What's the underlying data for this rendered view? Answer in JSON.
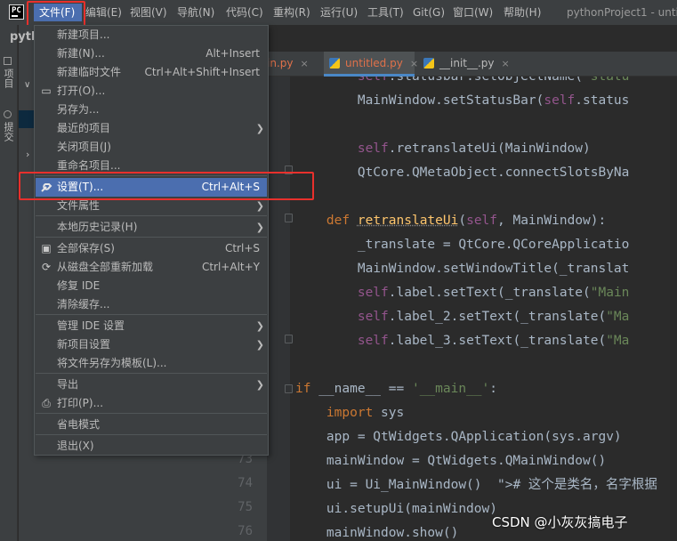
{
  "menubar": {
    "logo_text": "PC",
    "items": [
      "文件(F)",
      "编辑(E)",
      "视图(V)",
      "导航(N)",
      "代码(C)",
      "重构(R)",
      "运行(U)",
      "工具(T)",
      "Git(G)",
      "窗口(W)",
      "帮助(H)"
    ],
    "window_title": "pythonProject1 - untit"
  },
  "toolstrip": {
    "project_label": "项目",
    "commit_label": "提交"
  },
  "project_panel": {
    "title": "pyth",
    "chevron": "∨",
    "arrow": "›"
  },
  "tabs": [
    {
      "label": "in.py",
      "close": "×"
    },
    {
      "label": "untitled.py",
      "close": "×"
    },
    {
      "label": "__init__.py",
      "close": "×"
    }
  ],
  "file_menu": {
    "items": [
      {
        "label": "新建项目...",
        "shortcut": "",
        "icon": "",
        "submenu": false
      },
      {
        "label": "新建(N)...",
        "shortcut": "Alt+Insert",
        "icon": "",
        "submenu": false
      },
      {
        "label": "新建临时文件",
        "shortcut": "Ctrl+Alt+Shift+Insert",
        "icon": "",
        "submenu": false
      },
      {
        "label": "打开(O)...",
        "shortcut": "",
        "icon": "folder-icon",
        "submenu": false
      },
      {
        "label": "另存为...",
        "shortcut": "",
        "icon": "",
        "submenu": false
      },
      {
        "label": "最近的项目",
        "shortcut": "",
        "icon": "",
        "submenu": true
      },
      {
        "label": "关闭项目(J)",
        "shortcut": "",
        "icon": "",
        "submenu": false
      },
      {
        "label": "重命名项目...",
        "shortcut": "",
        "icon": "",
        "submenu": false
      },
      {
        "label": "设置(T)...",
        "shortcut": "Ctrl+Alt+S",
        "icon": "wrench-icon",
        "submenu": false,
        "active": true
      },
      {
        "label": "文件属性",
        "shortcut": "",
        "icon": "",
        "submenu": true
      },
      {
        "label": "本地历史记录(H)",
        "shortcut": "",
        "icon": "",
        "submenu": true
      },
      {
        "label": "全部保存(S)",
        "shortcut": "Ctrl+S",
        "icon": "save-icon",
        "submenu": false
      },
      {
        "label": "从磁盘全部重新加载",
        "shortcut": "Ctrl+Alt+Y",
        "icon": "reload-icon",
        "submenu": false
      },
      {
        "label": "修复 IDE",
        "shortcut": "",
        "icon": "",
        "submenu": false
      },
      {
        "label": "清除缓存...",
        "shortcut": "",
        "icon": "",
        "submenu": false
      },
      {
        "label": "管理 IDE 设置",
        "shortcut": "",
        "icon": "",
        "submenu": true
      },
      {
        "label": "新项目设置",
        "shortcut": "",
        "icon": "",
        "submenu": true
      },
      {
        "label": "将文件另存为模板(L)...",
        "shortcut": "",
        "icon": "",
        "submenu": false
      },
      {
        "label": "导出",
        "shortcut": "",
        "icon": "",
        "submenu": true
      },
      {
        "label": "打印(P)...",
        "shortcut": "",
        "icon": "print-icon",
        "submenu": false
      },
      {
        "label": "省电模式",
        "shortcut": "",
        "icon": "",
        "submenu": false
      },
      {
        "label": "退出(X)",
        "shortcut": "",
        "icon": "",
        "submenu": false
      }
    ]
  },
  "line_numbers": [
    "73",
    "74",
    "75",
    "76"
  ],
  "code_lines": [
    "        self.statusbar.setObjectName(\"statu",
    "        MainWindow.setStatusBar(self.status",
    "",
    "        self.retranslateUi(MainWindow)",
    "        QtCore.QMetaObject.connectSlotsByNa",
    "",
    "    def retranslateUi(self, MainWindow):",
    "        _translate = QtCore.QCoreApplicatio",
    "        MainWindow.setWindowTitle(_translat",
    "        self.label.setText(_translate(\"Main",
    "        self.label_2.setText(_translate(\"Ma",
    "        self.label_3.setText(_translate(\"Ma",
    "",
    "if __name__ == '__main__':",
    "    import sys",
    "    app = QtWidgets.QApplication(sys.argv)",
    "    mainWindow = QtWidgets.QMainWindow()",
    "    ui = Ui_MainWindow()  # 这个是类名，名字根据",
    "    ui.setupUi(mainWindow)",
    "    mainWindow.show()"
  ],
  "watermark": "CSDN @小灰灰搞电子",
  "colors": {
    "menu_bg": "#3c3f41",
    "editor_bg": "#2b2b2b",
    "selection": "#4b6eaf",
    "highlight_box": "#e8302c",
    "keyword": "#cc7832",
    "self": "#94558d",
    "string": "#6a8759",
    "function": "#ffc66d"
  }
}
